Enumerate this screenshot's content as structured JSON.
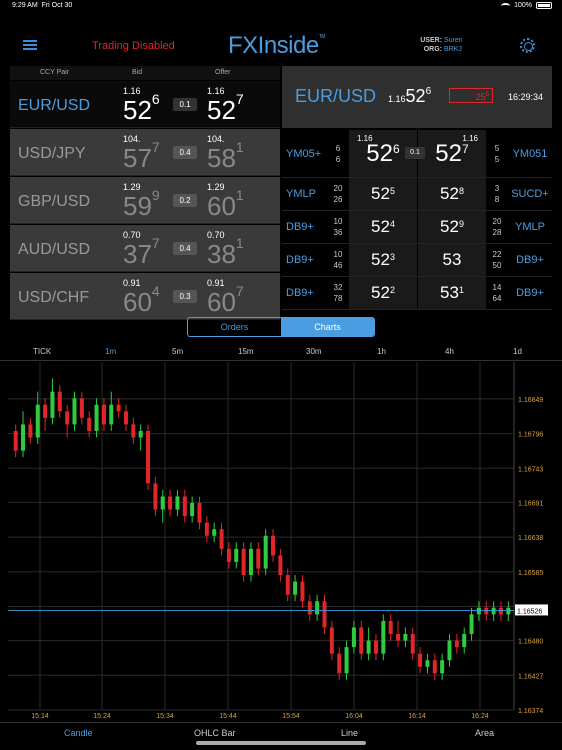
{
  "status_bar": {
    "time": "9:29 AM",
    "date": "Fri Oct 30",
    "battery": "100%"
  },
  "header": {
    "trading_status": "Trading Disabled",
    "logo": "FXInside",
    "logo_tm": "TM",
    "user_label": "USER:",
    "user": "Suren",
    "org_label": "ORG:",
    "org": "BRKJ"
  },
  "columns": {
    "pair": "CCY Pair",
    "bid": "Bid",
    "offer": "Offer"
  },
  "rates": [
    {
      "pair": "EUR/USD",
      "bid_pre": "1.16",
      "bid_main": "52",
      "bid_sup": "6",
      "spread": "0.1",
      "offer_pre": "1.16",
      "offer_main": "52",
      "offer_sup": "7"
    },
    {
      "pair": "USD/JPY",
      "bid_pre": "104.",
      "bid_main": "57",
      "bid_sup": "7",
      "spread": "0.4",
      "offer_pre": "104.",
      "offer_main": "58",
      "offer_sup": "1"
    },
    {
      "pair": "GBP/USD",
      "bid_pre": "1.29",
      "bid_main": "59",
      "bid_sup": "9",
      "spread": "0.2",
      "offer_pre": "1.29",
      "offer_main": "60",
      "offer_sup": "1"
    },
    {
      "pair": "AUD/USD",
      "bid_pre": "0.70",
      "bid_main": "37",
      "bid_sup": "7",
      "spread": "0.4",
      "offer_pre": "0.70",
      "offer_main": "38",
      "offer_sup": "1"
    },
    {
      "pair": "USD/CHF",
      "bid_pre": "0.91",
      "bid_main": "60",
      "bid_sup": "4",
      "spread": "0.3",
      "offer_pre": "0.91",
      "offer_main": "60",
      "offer_sup": "7"
    }
  ],
  "focus": {
    "pair": "EUR/USD",
    "rate_pre": "1.16",
    "rate_main": "52",
    "rate_sup": "6",
    "amount": "25",
    "amount_sup": "5",
    "time": "16:29:34"
  },
  "ladder": [
    {
      "bid_prov": "YM05+",
      "bid_sz1": "6",
      "bid_sz2": "6",
      "bid_pre": "1.16",
      "bid_main": "52",
      "bid_sup": "6",
      "spread": "0.1",
      "offer_pre": "1.16",
      "offer_main": "52",
      "offer_sup": "7",
      "offer_sz1": "5",
      "offer_sz2": "5",
      "offer_prov": "YM051"
    },
    {
      "bid_prov": "YMLP",
      "bid_sz1": "20",
      "bid_sz2": "26",
      "bid_main": "52",
      "bid_sup": "5",
      "offer_main": "52",
      "offer_sup": "8",
      "offer_sz1": "3",
      "offer_sz2": "8",
      "offer_prov": "SUCD+"
    },
    {
      "bid_prov": "DB9+",
      "bid_sz1": "10",
      "bid_sz2": "36",
      "bid_main": "52",
      "bid_sup": "4",
      "offer_main": "52",
      "offer_sup": "9",
      "offer_sz1": "20",
      "offer_sz2": "28",
      "offer_prov": "YMLP"
    },
    {
      "bid_prov": "DB9+",
      "bid_sz1": "10",
      "bid_sz2": "46",
      "bid_main": "52",
      "bid_sup": "3",
      "offer_main": "53",
      "offer_sup": "",
      "offer_sz1": "22",
      "offer_sz2": "50",
      "offer_prov": "DB9+"
    },
    {
      "bid_prov": "DB9+",
      "bid_sz1": "32",
      "bid_sz2": "78",
      "bid_main": "52",
      "bid_sup": "2",
      "offer_main": "53",
      "offer_sup": "1",
      "offer_sz1": "14",
      "offer_sz2": "64",
      "offer_prov": "DB9+"
    }
  ],
  "toggle": {
    "orders": "Orders",
    "charts": "Charts"
  },
  "timeframes": [
    "TICK",
    "1m",
    "5m",
    "15m",
    "30m",
    "1h",
    "4h",
    "1d"
  ],
  "bottom_tabs": [
    "Candle",
    "OHLC Bar",
    "Line",
    "Area"
  ],
  "chart_data": {
    "type": "candlestick",
    "y_ticks": [
      "1.16849",
      "1.16796",
      "1.16743",
      "1.16691",
      "1.16638",
      "1.16585",
      "1.16532",
      "1.16480",
      "1.16427",
      "1.16374"
    ],
    "x_ticks": [
      "15:14",
      "15:24",
      "15:34",
      "15:44",
      "15:54",
      "16:04",
      "16:14",
      "16:24"
    ],
    "current_price": "1.16526",
    "ylim": [
      1.16374,
      1.1689
    ],
    "colors": {
      "up": "#2ecc40",
      "down": "#e0262a",
      "grid": "#2a2a2a",
      "price_line": "#3aa0d8",
      "axis_text": "#d9a23a"
    },
    "candles": [
      {
        "o": 1.168,
        "c": 1.1677,
        "h": 1.1681,
        "l": 1.1676
      },
      {
        "o": 1.1677,
        "c": 1.1681,
        "h": 1.1683,
        "l": 1.1676
      },
      {
        "o": 1.1681,
        "c": 1.1679,
        "h": 1.1682,
        "l": 1.1678
      },
      {
        "o": 1.1679,
        "c": 1.1684,
        "h": 1.1686,
        "l": 1.1678
      },
      {
        "o": 1.1684,
        "c": 1.1682,
        "h": 1.1685,
        "l": 1.168
      },
      {
        "o": 1.1682,
        "c": 1.1686,
        "h": 1.1688,
        "l": 1.1681
      },
      {
        "o": 1.1686,
        "c": 1.1683,
        "h": 1.1687,
        "l": 1.1682
      },
      {
        "o": 1.1683,
        "c": 1.1681,
        "h": 1.1684,
        "l": 1.1679
      },
      {
        "o": 1.1681,
        "c": 1.1685,
        "h": 1.1686,
        "l": 1.168
      },
      {
        "o": 1.1685,
        "c": 1.1682,
        "h": 1.1686,
        "l": 1.1681
      },
      {
        "o": 1.1682,
        "c": 1.168,
        "h": 1.1683,
        "l": 1.1679
      },
      {
        "o": 1.168,
        "c": 1.1684,
        "h": 1.1685,
        "l": 1.1679
      },
      {
        "o": 1.1684,
        "c": 1.1681,
        "h": 1.1685,
        "l": 1.168
      },
      {
        "o": 1.1681,
        "c": 1.1684,
        "h": 1.1686,
        "l": 1.168
      },
      {
        "o": 1.1684,
        "c": 1.1683,
        "h": 1.1685,
        "l": 1.1682
      },
      {
        "o": 1.1683,
        "c": 1.1681,
        "h": 1.1684,
        "l": 1.168
      },
      {
        "o": 1.1681,
        "c": 1.1679,
        "h": 1.1682,
        "l": 1.1678
      },
      {
        "o": 1.1679,
        "c": 1.168,
        "h": 1.1681,
        "l": 1.1677
      },
      {
        "o": 1.168,
        "c": 1.1672,
        "h": 1.1681,
        "l": 1.1671
      },
      {
        "o": 1.1672,
        "c": 1.1668,
        "h": 1.1673,
        "l": 1.1667
      },
      {
        "o": 1.1668,
        "c": 1.167,
        "h": 1.1671,
        "l": 1.1666
      },
      {
        "o": 1.167,
        "c": 1.1668,
        "h": 1.1671,
        "l": 1.1667
      },
      {
        "o": 1.1668,
        "c": 1.167,
        "h": 1.1671,
        "l": 1.1667
      },
      {
        "o": 1.167,
        "c": 1.1667,
        "h": 1.1671,
        "l": 1.1666
      },
      {
        "o": 1.1667,
        "c": 1.1669,
        "h": 1.167,
        "l": 1.1666
      },
      {
        "o": 1.1669,
        "c": 1.1666,
        "h": 1.167,
        "l": 1.1665
      },
      {
        "o": 1.1666,
        "c": 1.1664,
        "h": 1.1667,
        "l": 1.1663
      },
      {
        "o": 1.1664,
        "c": 1.1665,
        "h": 1.1666,
        "l": 1.1663
      },
      {
        "o": 1.1665,
        "c": 1.1662,
        "h": 1.1666,
        "l": 1.1661
      },
      {
        "o": 1.1662,
        "c": 1.166,
        "h": 1.1663,
        "l": 1.1659
      },
      {
        "o": 1.166,
        "c": 1.1662,
        "h": 1.1663,
        "l": 1.1659
      },
      {
        "o": 1.1662,
        "c": 1.1658,
        "h": 1.1663,
        "l": 1.1657
      },
      {
        "o": 1.1658,
        "c": 1.1662,
        "h": 1.1663,
        "l": 1.1657
      },
      {
        "o": 1.1662,
        "c": 1.1659,
        "h": 1.1663,
        "l": 1.1658
      },
      {
        "o": 1.1659,
        "c": 1.1664,
        "h": 1.1665,
        "l": 1.1658
      },
      {
        "o": 1.1664,
        "c": 1.1661,
        "h": 1.1665,
        "l": 1.166
      },
      {
        "o": 1.1661,
        "c": 1.1658,
        "h": 1.1662,
        "l": 1.1657
      },
      {
        "o": 1.1658,
        "c": 1.1655,
        "h": 1.1659,
        "l": 1.1654
      },
      {
        "o": 1.1655,
        "c": 1.1657,
        "h": 1.1658,
        "l": 1.1654
      },
      {
        "o": 1.1657,
        "c": 1.1654,
        "h": 1.1658,
        "l": 1.1653
      },
      {
        "o": 1.1654,
        "c": 1.1652,
        "h": 1.1655,
        "l": 1.1651
      },
      {
        "o": 1.1652,
        "c": 1.1654,
        "h": 1.1655,
        "l": 1.1651
      },
      {
        "o": 1.1654,
        "c": 1.165,
        "h": 1.1655,
        "l": 1.1649
      },
      {
        "o": 1.165,
        "c": 1.1646,
        "h": 1.1651,
        "l": 1.1645
      },
      {
        "o": 1.1646,
        "c": 1.1643,
        "h": 1.1647,
        "l": 1.1642
      },
      {
        "o": 1.1643,
        "c": 1.1647,
        "h": 1.1648,
        "l": 1.1642
      },
      {
        "o": 1.1647,
        "c": 1.165,
        "h": 1.1651,
        "l": 1.1646
      },
      {
        "o": 1.165,
        "c": 1.1646,
        "h": 1.1651,
        "l": 1.1645
      },
      {
        "o": 1.1646,
        "c": 1.1648,
        "h": 1.165,
        "l": 1.1645
      },
      {
        "o": 1.1648,
        "c": 1.1646,
        "h": 1.1649,
        "l": 1.1645
      },
      {
        "o": 1.1646,
        "c": 1.1651,
        "h": 1.1652,
        "l": 1.1645
      },
      {
        "o": 1.1651,
        "c": 1.1649,
        "h": 1.1652,
        "l": 1.1648
      },
      {
        "o": 1.1649,
        "c": 1.1648,
        "h": 1.1651,
        "l": 1.1647
      },
      {
        "o": 1.1648,
        "c": 1.1649,
        "h": 1.165,
        "l": 1.1647
      },
      {
        "o": 1.1649,
        "c": 1.1646,
        "h": 1.165,
        "l": 1.1645
      },
      {
        "o": 1.1646,
        "c": 1.1644,
        "h": 1.1647,
        "l": 1.1643
      },
      {
        "o": 1.1644,
        "c": 1.1645,
        "h": 1.1646,
        "l": 1.1643
      },
      {
        "o": 1.1645,
        "c": 1.1643,
        "h": 1.1646,
        "l": 1.1642
      },
      {
        "o": 1.1643,
        "c": 1.1645,
        "h": 1.1646,
        "l": 1.1642
      },
      {
        "o": 1.1645,
        "c": 1.1648,
        "h": 1.1649,
        "l": 1.1644
      },
      {
        "o": 1.1648,
        "c": 1.1647,
        "h": 1.1649,
        "l": 1.1646
      },
      {
        "o": 1.1647,
        "c": 1.1649,
        "h": 1.165,
        "l": 1.1646
      },
      {
        "o": 1.1649,
        "c": 1.1652,
        "h": 1.1653,
        "l": 1.1648
      },
      {
        "o": 1.1652,
        "c": 1.1653,
        "h": 1.1654,
        "l": 1.1651
      },
      {
        "o": 1.1653,
        "c": 1.1652,
        "h": 1.1654,
        "l": 1.1651
      },
      {
        "o": 1.1652,
        "c": 1.1653,
        "h": 1.1654,
        "l": 1.1651
      },
      {
        "o": 1.1653,
        "c": 1.1652,
        "h": 1.1654,
        "l": 1.1651
      },
      {
        "o": 1.1652,
        "c": 1.1653,
        "h": 1.1654,
        "l": 1.1651
      }
    ]
  }
}
